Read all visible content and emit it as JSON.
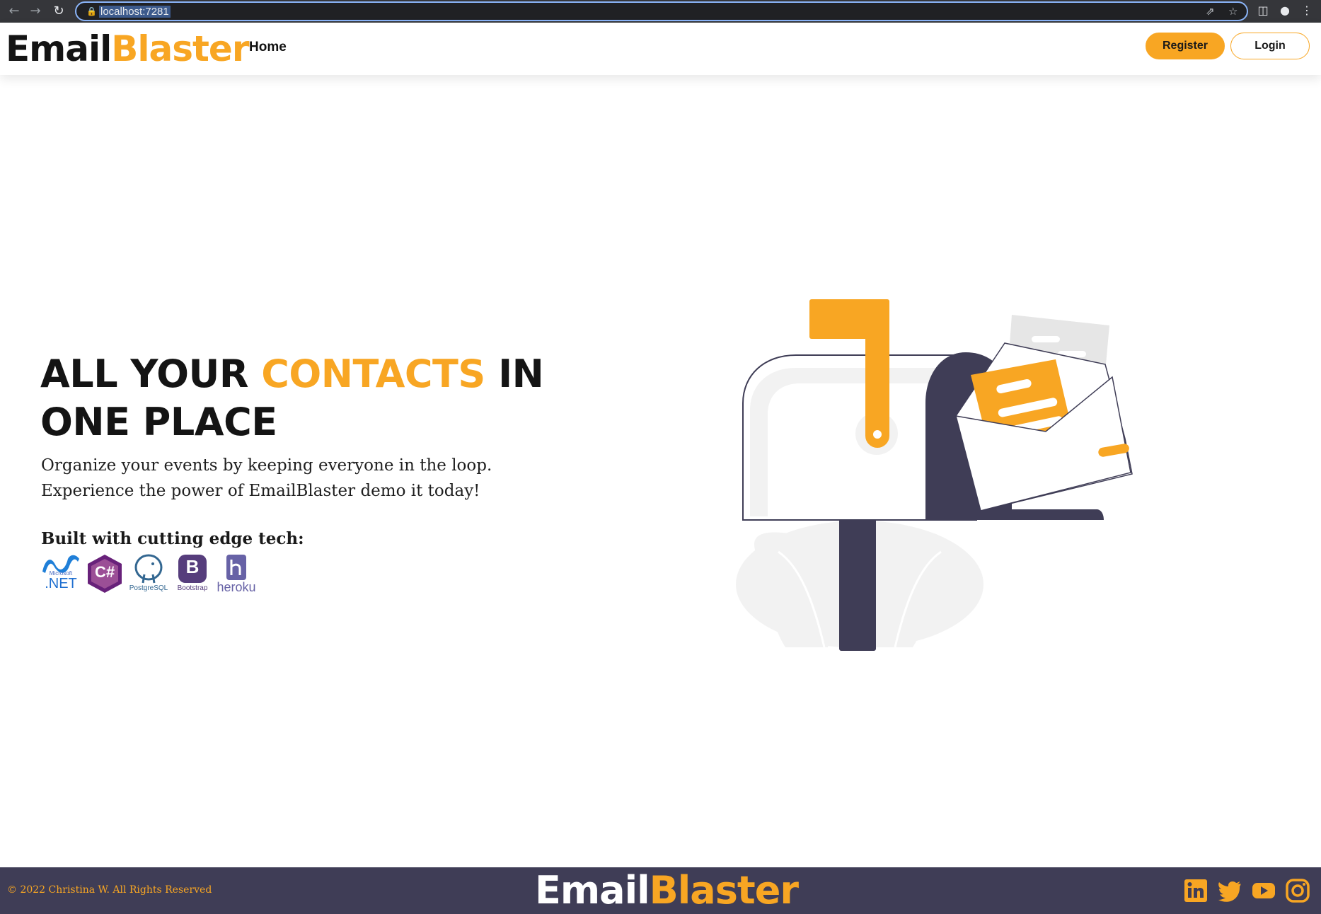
{
  "browser": {
    "url": "localhost:7281",
    "icons": [
      "back-arrow-icon",
      "forward-arrow-icon",
      "reload-icon",
      "lock-icon",
      "share-icon",
      "star-icon",
      "side-panel-icon",
      "profile-icon",
      "menu-kebab-icon"
    ]
  },
  "navbar": {
    "brand_part1": "Email",
    "brand_part2": "Blaster",
    "home_link": "Home",
    "register_label": "Register",
    "login_label": "Login"
  },
  "hero": {
    "title_part1": "ALL YOUR ",
    "title_accent": "CONTACTS",
    "title_part2": " IN ONE PLACE",
    "subtitle": "Organize your events by keeping everyone in the loop. Experience the power of EmailBlaster demo it today!",
    "tech_heading": "Built with cutting edge tech:",
    "tech_logos": {
      "dotnet_small": "Microsoft",
      "dotnet_big": ".NET",
      "csharp": "C#",
      "postgres": "PostgreSQL",
      "bootstrap_letter": "B",
      "bootstrap": "Bootstrap",
      "heroku": "heroku"
    }
  },
  "footer": {
    "copyright": "© 2022 Christina W. All Rights Reserved",
    "brand_part1": "Email",
    "brand_part2": "Blaster",
    "social_icons": [
      "linkedin-icon",
      "twitter-icon",
      "youtube-icon",
      "instagram-icon"
    ]
  },
  "colors": {
    "accent": "#f8a623",
    "dark_navy": "#3f3d56",
    "text_dark": "#141414"
  }
}
